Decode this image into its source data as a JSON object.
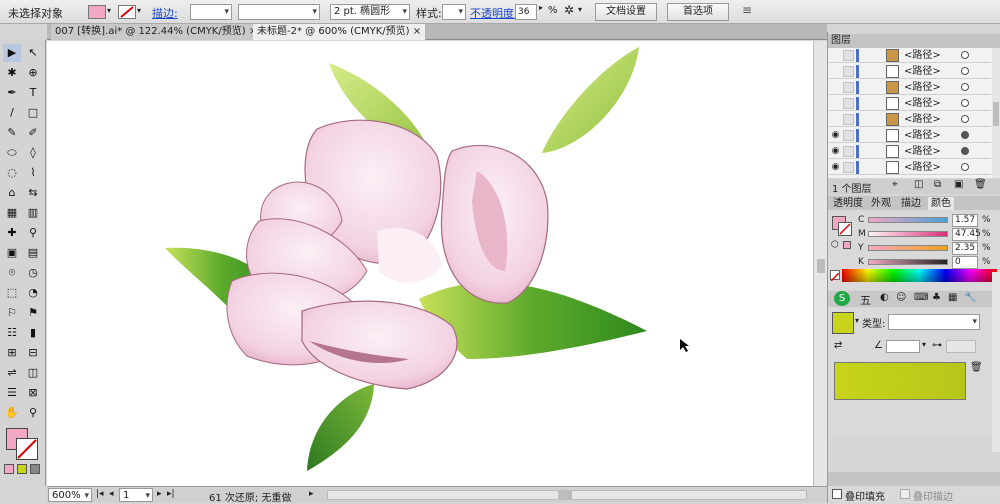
{
  "control_bar": {
    "selection_status": "未选择对象",
    "stroke_link": "描边:",
    "stroke_width": "2 pt. 椭圆形",
    "style_label": "样式:",
    "opacity_link": "不透明度:",
    "opacity_value": "36",
    "opacity_unit": "%",
    "doc_setup_button": "文档设置",
    "preferences_button": "首选项"
  },
  "doc_tabs": [
    {
      "label": "007 [转换].ai* @ 122.44% (CMYK/预览)",
      "active": false
    },
    {
      "label": "未标题-2* @ 600% (CMYK/预览)",
      "active": true
    }
  ],
  "tools": [
    "▶",
    "↖",
    "✱",
    "⊕",
    "✒",
    "T",
    "/",
    "□",
    "✎",
    "✐",
    "⬭",
    "◊",
    "◌",
    "⌇",
    "⌂",
    "⇆",
    "▦",
    "▥",
    "✚",
    "⚲",
    "▣",
    "▤",
    "⌾",
    "◷",
    "⬚",
    "◔",
    "⚐",
    "⚑",
    "☷",
    "▮",
    "⊞",
    "⊟",
    "⇌",
    "◫",
    "☰",
    "⊠",
    "✋",
    "⚲"
  ],
  "status_bar": {
    "zoom": "600%",
    "page": "1",
    "undo_info": "61 次还原; 无重做"
  },
  "layers_panel": {
    "title": "图层",
    "rows": [
      {
        "name": "<路径>",
        "eye": false,
        "thumb": "#c9964a",
        "target": "#ffffff"
      },
      {
        "name": "<路径>",
        "eye": false,
        "thumb": "#ffffff",
        "target": "#ffffff"
      },
      {
        "name": "<路径>",
        "eye": false,
        "thumb": "#c9964a",
        "target": "#ffffff"
      },
      {
        "name": "<路径>",
        "eye": false,
        "thumb": "#ffffff",
        "target": "#ffffff"
      },
      {
        "name": "<路径>",
        "eye": false,
        "thumb": "#c9964a",
        "target": "#ffffff"
      },
      {
        "name": "<路径>",
        "eye": true,
        "thumb": "#ffffff",
        "target": "#555555"
      },
      {
        "name": "<路径>",
        "eye": true,
        "thumb": "#ffffff",
        "target": "#555555"
      },
      {
        "name": "<路径>",
        "eye": true,
        "thumb": "#ffffff",
        "target": "#ffffff"
      }
    ],
    "footer": "1 个图层"
  },
  "color_panel": {
    "tabs": [
      "透明度",
      "外观",
      "描边",
      "颜色"
    ],
    "active_tab": "颜色",
    "fill_color": "#f2a8c4",
    "channels": [
      {
        "label": "C",
        "value": "1.57",
        "grad": "linear-gradient(90deg,#f2a8c4,#4aa0d8)"
      },
      {
        "label": "M",
        "value": "47.45",
        "grad": "linear-gradient(90deg,#fff5f8,#d8307a)"
      },
      {
        "label": "Y",
        "value": "2.35",
        "grad": "linear-gradient(90deg,#f2a8c4,#f0a020)"
      },
      {
        "label": "K",
        "value": "0",
        "grad": "linear-gradient(90deg,#f2a8c4,#222222)"
      }
    ],
    "unit": "%"
  },
  "swatch_panel": {
    "type_label": "类型:",
    "current_color": "#c8d41a"
  },
  "bottom_panel": {
    "overprint_fill": "叠印填充",
    "overprint_stroke": "叠印描边"
  }
}
